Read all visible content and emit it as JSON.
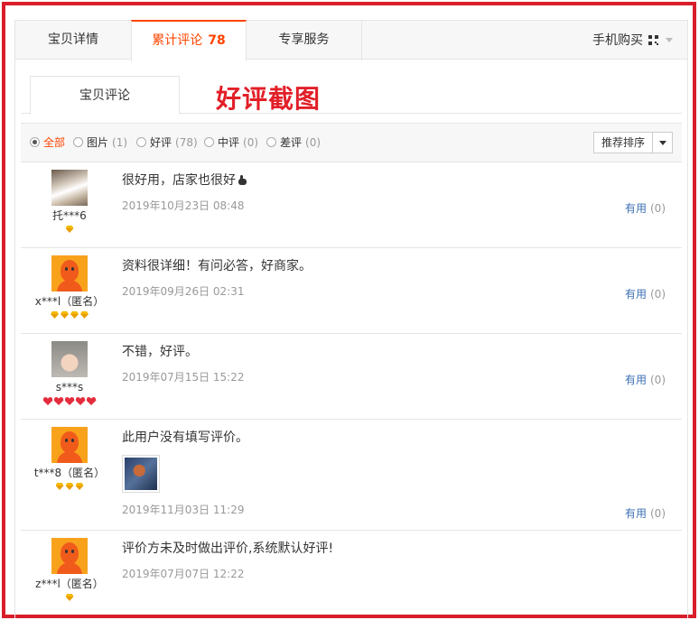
{
  "tabs": {
    "detail": "宝贝详情",
    "reviews_label": "累计评论",
    "reviews_count": "78",
    "service": "专享服务",
    "mobile_buy": "手机购买"
  },
  "subtab": {
    "label": "宝贝评论"
  },
  "annotation": "好评截图",
  "filters": {
    "all": {
      "label": "全部",
      "count": ""
    },
    "pic": {
      "label": "图片",
      "count": "(1)"
    },
    "good": {
      "label": "好评",
      "count": "(78)"
    },
    "mid": {
      "label": "中评",
      "count": "(0)"
    },
    "bad": {
      "label": "差评",
      "count": "(0)"
    },
    "sort": "推荐排序"
  },
  "reviews": [
    {
      "user": "托***6",
      "text": "很好用，店家也很好",
      "date": "2019年10月23日 08:48",
      "useful_label": "有用",
      "useful_count": "(0)",
      "level": "1-gem"
    },
    {
      "user": "x***l（匿名）",
      "text": "资料很详细！有问必答，好商家。",
      "date": "2019年09月26日 02:31",
      "useful_label": "有用",
      "useful_count": "(0)",
      "level": "4-gem"
    },
    {
      "user": "s***s",
      "text": "不错，好评。",
      "date": "2019年07月15日 15:22",
      "useful_label": "有用",
      "useful_count": "(0)",
      "level": "5-heart"
    },
    {
      "user": "t***8（匿名）",
      "text": "此用户没有填写评价。",
      "date": "2019年11月03日 11:29",
      "useful_label": "有用",
      "useful_count": "(0)",
      "level": "3-gem"
    },
    {
      "user": "z***l（匿名）",
      "text": "评价方未及时做出评价,系统默认好评!",
      "date": "2019年07月07日 12:22",
      "level": "1-gem"
    }
  ],
  "colors": {
    "accent": "#ff4400",
    "annotation": "#e21f28",
    "frame": "#d91e2a",
    "link": "#3c6fb5"
  }
}
